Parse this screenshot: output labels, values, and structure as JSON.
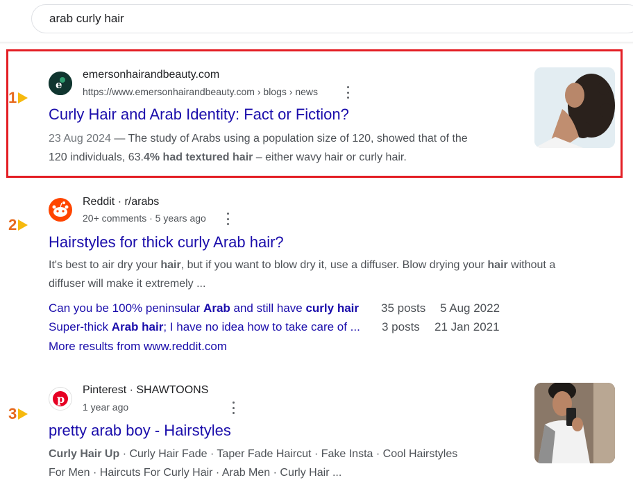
{
  "search": {
    "query": "arab curly hair"
  },
  "results": [
    {
      "marker": "1",
      "site_name": "emersonhairandbeauty.com",
      "site_url": "https://www.emersonhairandbeauty.com › blogs › news",
      "title": "Curly Hair and Arab Identity: Fact or Fiction?",
      "date": "23 Aug 2024",
      "snippet_1": " — The study of Arabs using a population size of 120, showed that of the",
      "snippet_2a": "120 individuals, 63.",
      "snippet_2b": "4% had textured hair",
      "snippet_2c": " – either wavy hair or curly hair."
    },
    {
      "marker": "2",
      "site_name": "Reddit · r/arabs",
      "site_meta": "20+ comments · 5 years ago",
      "title": "Hairstyles for thick curly Arab hair?",
      "snippet_1a": "It's best to air dry your ",
      "snippet_1b": "hair",
      "snippet_1c": ", but if you want to blow dry it, use a diffuser. Blow drying your ",
      "snippet_1d": "hair",
      "snippet_1e": " without a",
      "snippet_2": "diffuser will make it extremely ...",
      "sublinks": [
        {
          "a": "Can you be 100% peninsular ",
          "b": "Arab",
          "c": " and still have ",
          "d": "curly hair",
          "posts": "35 posts",
          "date": "5 Aug 2022"
        },
        {
          "a": "Super-thick ",
          "b": "Arab hair",
          "c": "; I have no idea how to take care of ...",
          "posts": "3 posts",
          "date": "21 Jan 2021"
        }
      ],
      "more_results": "More results from www.reddit.com"
    },
    {
      "marker": "3",
      "site_name": "Pinterest · SHAWTOONS",
      "site_meta": "1 year ago",
      "title": "pretty arab boy - Hairstyles",
      "snippet_1a": "Curly Hair Up",
      "snippet_1b": " · Curly Hair Fade · Taper Fade Haircut · Fake Insta · Cool Hairstyles",
      "snippet_2": "For Men · Haircuts For Curly Hair · Arab Men · Curly Hair ..."
    }
  ],
  "colors": {
    "link": "#1a0dab",
    "highlight_box": "#e31e24",
    "marker_number": "#e66a1f",
    "marker_arrow": "#f6b90e",
    "reddit": "#ff4500",
    "pinterest": "#e60023"
  },
  "icons": {
    "result_1": "emerson-logo-icon",
    "result_2": "reddit-icon",
    "result_3": "pinterest-icon",
    "menu": "more-vert-icon"
  }
}
